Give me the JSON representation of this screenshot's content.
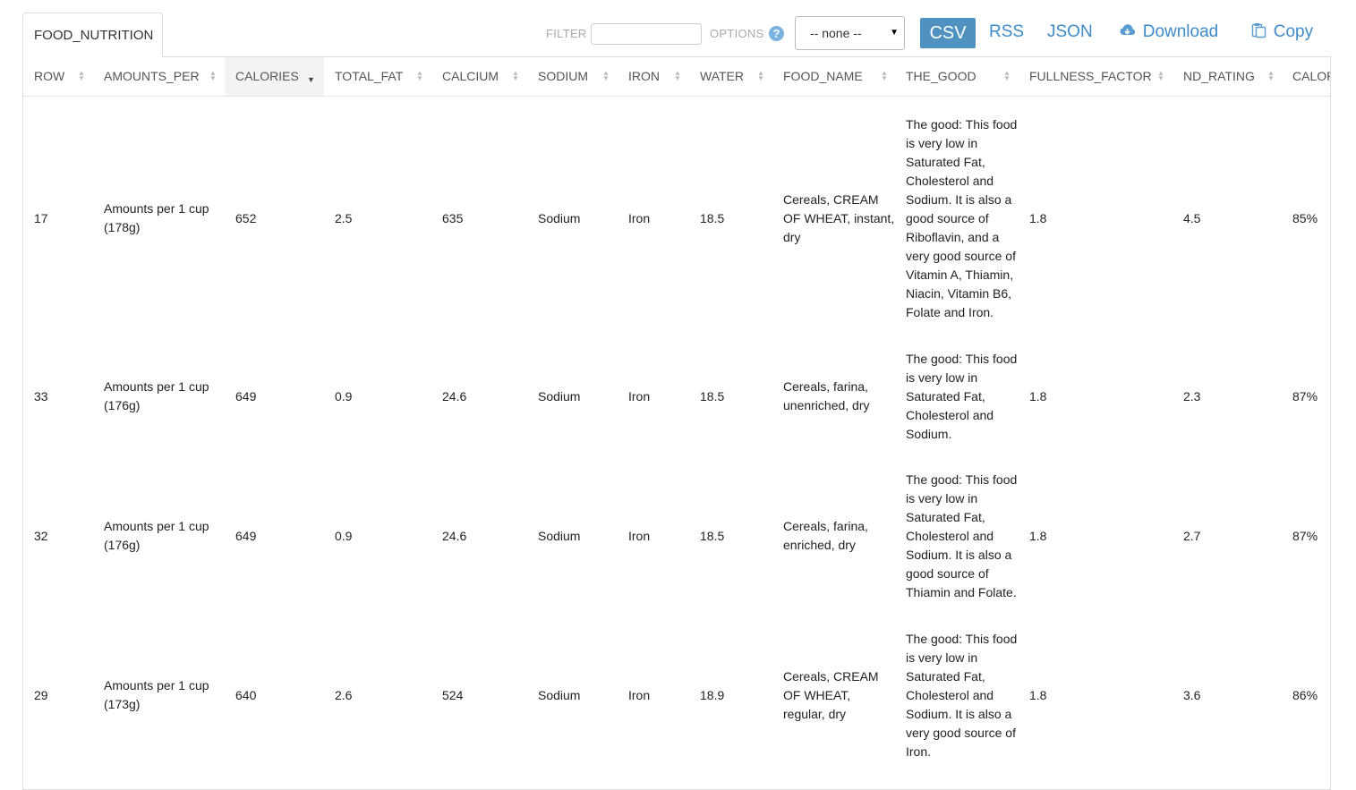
{
  "tab": {
    "label": "FOOD_NUTRITION"
  },
  "toolbar": {
    "filter_label": "FILTER",
    "filter_value": "",
    "options_label": "OPTIONS",
    "help_icon": "?",
    "select_value": "-- none --",
    "csv_label": "CSV",
    "rss_label": "RSS",
    "json_label": "JSON",
    "download_label": "Download",
    "copy_label": "Copy",
    "accent_color": "#4f92c0"
  },
  "table": {
    "columns": [
      "ROW",
      "AMOUNTS_PER",
      "CALORIES",
      "TOTAL_FAT",
      "CALCIUM",
      "SODIUM",
      "IRON",
      "WATER",
      "FOOD_NAME",
      "THE_GOOD",
      "FULLNESS_FACTOR",
      "ND_RATING",
      "CALOR"
    ],
    "sorted_column": "CALORIES",
    "rows": [
      {
        "row": "17",
        "amounts_per": "Amounts per 1 cup (178g)",
        "calories": "652",
        "total_fat": "2.5",
        "calcium": "635",
        "sodium": "Sodium",
        "iron": "Iron",
        "water": "18.5",
        "food_name": "Cereals, CREAM OF WHEAT, instant, dry",
        "the_good": "The good: This food is very low in Saturated Fat, Cholesterol and Sodium. It is also a good source of Riboflavin, and a very good source of Vitamin A, Thiamin, Niacin, Vitamin B6, Folate and Iron.",
        "fullness_factor": "1.8",
        "nd_rating": "4.5",
        "calor": "85%"
      },
      {
        "row": "33",
        "amounts_per": "Amounts per 1 cup (176g)",
        "calories": "649",
        "total_fat": "0.9",
        "calcium": "24.6",
        "sodium": "Sodium",
        "iron": "Iron",
        "water": "18.5",
        "food_name": "Cereals, farina, unenriched, dry",
        "the_good": "The good: This food is very low in Saturated Fat, Cholesterol and Sodium.",
        "fullness_factor": "1.8",
        "nd_rating": "2.3",
        "calor": "87%"
      },
      {
        "row": "32",
        "amounts_per": "Amounts per 1 cup (176g)",
        "calories": "649",
        "total_fat": "0.9",
        "calcium": "24.6",
        "sodium": "Sodium",
        "iron": "Iron",
        "water": "18.5",
        "food_name": "Cereals, farina, enriched, dry",
        "the_good": "The good: This food is very low in Saturated Fat, Cholesterol and Sodium. It is also a good source of Thiamin and Folate.",
        "fullness_factor": "1.8",
        "nd_rating": "2.7",
        "calor": "87%"
      },
      {
        "row": "29",
        "amounts_per": "Amounts per 1 cup (173g)",
        "calories": "640",
        "total_fat": "2.6",
        "calcium": "524",
        "sodium": "Sodium",
        "iron": "Iron",
        "water": "18.9",
        "food_name": "Cereals, CREAM OF WHEAT, regular, dry",
        "the_good": "The good: This food is very low in Saturated Fat, Cholesterol and Sodium. It is also a very good source of Iron.",
        "fullness_factor": "1.8",
        "nd_rating": "3.6",
        "calor": "86%"
      }
    ]
  }
}
